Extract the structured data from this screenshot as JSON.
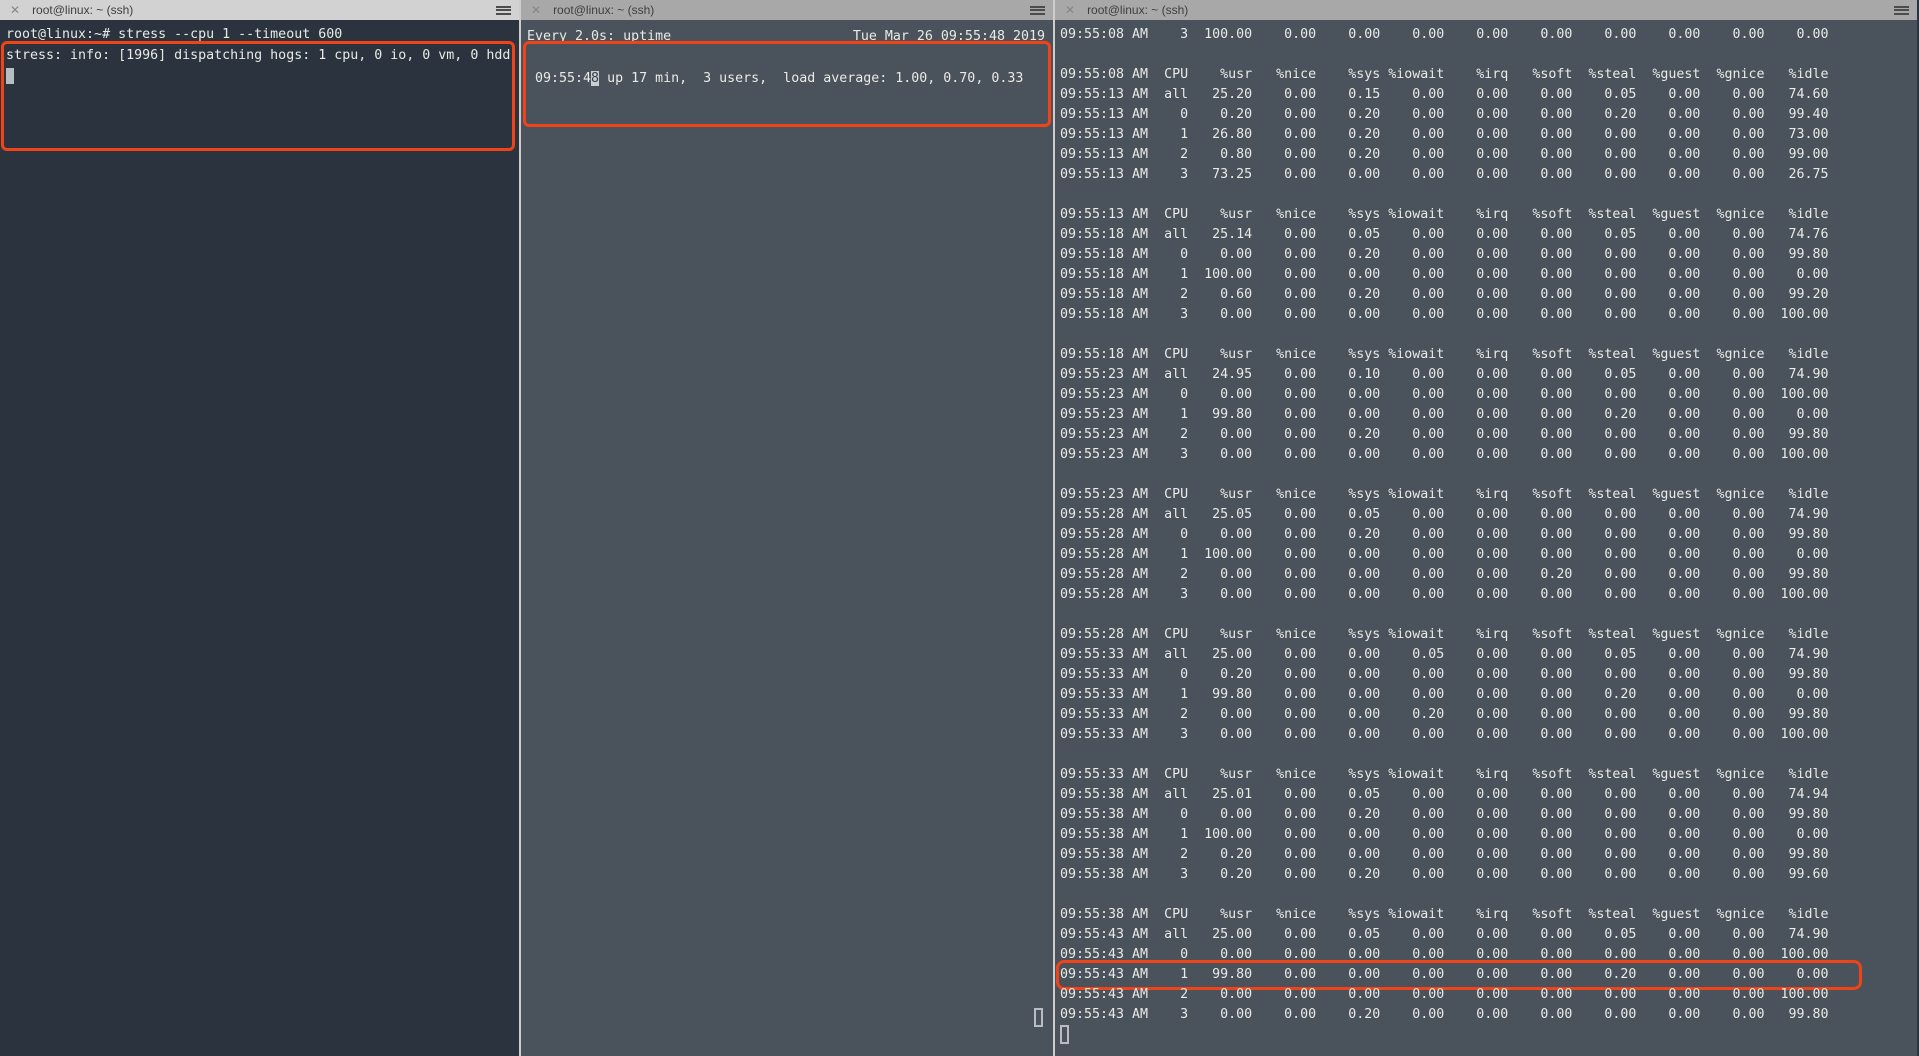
{
  "colors": {
    "accent_red": "#f04318",
    "left_pane_bg": "#2b333f",
    "slate_pane_bg": "#4a525c",
    "active_title_bg": "#d2d2d2",
    "inactive_title_bg": "#a8a8a8"
  },
  "panes": {
    "left": {
      "title": "root@linux: ~ (ssh)",
      "line1": "root@linux:~# stress --cpu 1 --timeout 600",
      "line2": "stress: info: [1996] dispatching hogs: 1 cpu, 0 io, 0 vm, 0 hdd"
    },
    "middle": {
      "title": "root@linux: ~ (ssh)",
      "watch_left": "Every 2.0s: uptime",
      "watch_right": "Tue Mar 26 09:55:48 2019",
      "uptime_pre": " 09:55:4",
      "uptime_cursor_char": "8",
      "uptime_post": " up 17 min,  3 users,  load average: 1.00, 0.70, 0.33"
    },
    "right": {
      "title": "root@linux: ~ (ssh)",
      "first_row": {
        "time": "09:55:08 AM",
        "cpu": "3",
        "values": [
          "100.00",
          "0.00",
          "0.00",
          "0.00",
          "0.00",
          "0.00",
          "0.00",
          "0.00",
          "0.00",
          "0.00"
        ]
      },
      "header_cols": [
        "CPU",
        "%usr",
        "%nice",
        "%sys",
        "%iowait",
        "%irq",
        "%soft",
        "%steal",
        "%guest",
        "%gnice",
        "%idle"
      ],
      "blocks": [
        {
          "header_time": "09:55:08 AM",
          "rows": [
            {
              "time": "09:55:13 AM",
              "cpu": "all",
              "values": [
                "25.20",
                "0.00",
                "0.15",
                "0.00",
                "0.00",
                "0.00",
                "0.05",
                "0.00",
                "0.00",
                "74.60"
              ]
            },
            {
              "time": "09:55:13 AM",
              "cpu": "0",
              "values": [
                "0.20",
                "0.00",
                "0.20",
                "0.00",
                "0.00",
                "0.00",
                "0.20",
                "0.00",
                "0.00",
                "99.40"
              ]
            },
            {
              "time": "09:55:13 AM",
              "cpu": "1",
              "values": [
                "26.80",
                "0.00",
                "0.20",
                "0.00",
                "0.00",
                "0.00",
                "0.00",
                "0.00",
                "0.00",
                "73.00"
              ]
            },
            {
              "time": "09:55:13 AM",
              "cpu": "2",
              "values": [
                "0.80",
                "0.00",
                "0.20",
                "0.00",
                "0.00",
                "0.00",
                "0.00",
                "0.00",
                "0.00",
                "99.00"
              ]
            },
            {
              "time": "09:55:13 AM",
              "cpu": "3",
              "values": [
                "73.25",
                "0.00",
                "0.00",
                "0.00",
                "0.00",
                "0.00",
                "0.00",
                "0.00",
                "0.00",
                "26.75"
              ]
            }
          ]
        },
        {
          "header_time": "09:55:13 AM",
          "rows": [
            {
              "time": "09:55:18 AM",
              "cpu": "all",
              "values": [
                "25.14",
                "0.00",
                "0.05",
                "0.00",
                "0.00",
                "0.00",
                "0.05",
                "0.00",
                "0.00",
                "74.76"
              ]
            },
            {
              "time": "09:55:18 AM",
              "cpu": "0",
              "values": [
                "0.00",
                "0.00",
                "0.20",
                "0.00",
                "0.00",
                "0.00",
                "0.00",
                "0.00",
                "0.00",
                "99.80"
              ]
            },
            {
              "time": "09:55:18 AM",
              "cpu": "1",
              "values": [
                "100.00",
                "0.00",
                "0.00",
                "0.00",
                "0.00",
                "0.00",
                "0.00",
                "0.00",
                "0.00",
                "0.00"
              ]
            },
            {
              "time": "09:55:18 AM",
              "cpu": "2",
              "values": [
                "0.60",
                "0.00",
                "0.20",
                "0.00",
                "0.00",
                "0.00",
                "0.00",
                "0.00",
                "0.00",
                "99.20"
              ]
            },
            {
              "time": "09:55:18 AM",
              "cpu": "3",
              "values": [
                "0.00",
                "0.00",
                "0.00",
                "0.00",
                "0.00",
                "0.00",
                "0.00",
                "0.00",
                "0.00",
                "100.00"
              ]
            }
          ]
        },
        {
          "header_time": "09:55:18 AM",
          "rows": [
            {
              "time": "09:55:23 AM",
              "cpu": "all",
              "values": [
                "24.95",
                "0.00",
                "0.10",
                "0.00",
                "0.00",
                "0.00",
                "0.05",
                "0.00",
                "0.00",
                "74.90"
              ]
            },
            {
              "time": "09:55:23 AM",
              "cpu": "0",
              "values": [
                "0.00",
                "0.00",
                "0.00",
                "0.00",
                "0.00",
                "0.00",
                "0.00",
                "0.00",
                "0.00",
                "100.00"
              ]
            },
            {
              "time": "09:55:23 AM",
              "cpu": "1",
              "values": [
                "99.80",
                "0.00",
                "0.00",
                "0.00",
                "0.00",
                "0.00",
                "0.20",
                "0.00",
                "0.00",
                "0.00"
              ]
            },
            {
              "time": "09:55:23 AM",
              "cpu": "2",
              "values": [
                "0.00",
                "0.00",
                "0.20",
                "0.00",
                "0.00",
                "0.00",
                "0.00",
                "0.00",
                "0.00",
                "99.80"
              ]
            },
            {
              "time": "09:55:23 AM",
              "cpu": "3",
              "values": [
                "0.00",
                "0.00",
                "0.00",
                "0.00",
                "0.00",
                "0.00",
                "0.00",
                "0.00",
                "0.00",
                "100.00"
              ]
            }
          ]
        },
        {
          "header_time": "09:55:23 AM",
          "rows": [
            {
              "time": "09:55:28 AM",
              "cpu": "all",
              "values": [
                "25.05",
                "0.00",
                "0.05",
                "0.00",
                "0.00",
                "0.00",
                "0.00",
                "0.00",
                "0.00",
                "74.90"
              ]
            },
            {
              "time": "09:55:28 AM",
              "cpu": "0",
              "values": [
                "0.00",
                "0.00",
                "0.20",
                "0.00",
                "0.00",
                "0.00",
                "0.00",
                "0.00",
                "0.00",
                "99.80"
              ]
            },
            {
              "time": "09:55:28 AM",
              "cpu": "1",
              "values": [
                "100.00",
                "0.00",
                "0.00",
                "0.00",
                "0.00",
                "0.00",
                "0.00",
                "0.00",
                "0.00",
                "0.00"
              ]
            },
            {
              "time": "09:55:28 AM",
              "cpu": "2",
              "values": [
                "0.00",
                "0.00",
                "0.00",
                "0.00",
                "0.00",
                "0.20",
                "0.00",
                "0.00",
                "0.00",
                "99.80"
              ]
            },
            {
              "time": "09:55:28 AM",
              "cpu": "3",
              "values": [
                "0.00",
                "0.00",
                "0.00",
                "0.00",
                "0.00",
                "0.00",
                "0.00",
                "0.00",
                "0.00",
                "100.00"
              ]
            }
          ]
        },
        {
          "header_time": "09:55:28 AM",
          "rows": [
            {
              "time": "09:55:33 AM",
              "cpu": "all",
              "values": [
                "25.00",
                "0.00",
                "0.00",
                "0.05",
                "0.00",
                "0.00",
                "0.05",
                "0.00",
                "0.00",
                "74.90"
              ]
            },
            {
              "time": "09:55:33 AM",
              "cpu": "0",
              "values": [
                "0.20",
                "0.00",
                "0.00",
                "0.00",
                "0.00",
                "0.00",
                "0.00",
                "0.00",
                "0.00",
                "99.80"
              ]
            },
            {
              "time": "09:55:33 AM",
              "cpu": "1",
              "values": [
                "99.80",
                "0.00",
                "0.00",
                "0.00",
                "0.00",
                "0.00",
                "0.20",
                "0.00",
                "0.00",
                "0.00"
              ]
            },
            {
              "time": "09:55:33 AM",
              "cpu": "2",
              "values": [
                "0.00",
                "0.00",
                "0.00",
                "0.20",
                "0.00",
                "0.00",
                "0.00",
                "0.00",
                "0.00",
                "99.80"
              ]
            },
            {
              "time": "09:55:33 AM",
              "cpu": "3",
              "values": [
                "0.00",
                "0.00",
                "0.00",
                "0.00",
                "0.00",
                "0.00",
                "0.00",
                "0.00",
                "0.00",
                "100.00"
              ]
            }
          ]
        },
        {
          "header_time": "09:55:33 AM",
          "rows": [
            {
              "time": "09:55:38 AM",
              "cpu": "all",
              "values": [
                "25.01",
                "0.00",
                "0.05",
                "0.00",
                "0.00",
                "0.00",
                "0.00",
                "0.00",
                "0.00",
                "74.94"
              ]
            },
            {
              "time": "09:55:38 AM",
              "cpu": "0",
              "values": [
                "0.00",
                "0.00",
                "0.20",
                "0.00",
                "0.00",
                "0.00",
                "0.00",
                "0.00",
                "0.00",
                "99.80"
              ]
            },
            {
              "time": "09:55:38 AM",
              "cpu": "1",
              "values": [
                "100.00",
                "0.00",
                "0.00",
                "0.00",
                "0.00",
                "0.00",
                "0.00",
                "0.00",
                "0.00",
                "0.00"
              ]
            },
            {
              "time": "09:55:38 AM",
              "cpu": "2",
              "values": [
                "0.20",
                "0.00",
                "0.00",
                "0.00",
                "0.00",
                "0.00",
                "0.00",
                "0.00",
                "0.00",
                "99.80"
              ]
            },
            {
              "time": "09:55:38 AM",
              "cpu": "3",
              "values": [
                "0.20",
                "0.00",
                "0.20",
                "0.00",
                "0.00",
                "0.00",
                "0.00",
                "0.00",
                "0.00",
                "99.60"
              ]
            }
          ]
        },
        {
          "header_time": "09:55:38 AM",
          "rows": [
            {
              "time": "09:55:43 AM",
              "cpu": "all",
              "values": [
                "25.00",
                "0.00",
                "0.05",
                "0.00",
                "0.00",
                "0.00",
                "0.05",
                "0.00",
                "0.00",
                "74.90"
              ]
            },
            {
              "time": "09:55:43 AM",
              "cpu": "0",
              "values": [
                "0.00",
                "0.00",
                "0.00",
                "0.00",
                "0.00",
                "0.00",
                "0.00",
                "0.00",
                "0.00",
                "100.00"
              ]
            },
            {
              "time": "09:55:43 AM",
              "cpu": "1",
              "values": [
                "99.80",
                "0.00",
                "0.00",
                "0.00",
                "0.00",
                "0.00",
                "0.20",
                "0.00",
                "0.00",
                "0.00"
              ]
            },
            {
              "time": "09:55:43 AM",
              "cpu": "2",
              "values": [
                "0.00",
                "0.00",
                "0.00",
                "0.00",
                "0.00",
                "0.00",
                "0.00",
                "0.00",
                "0.00",
                "100.00"
              ]
            },
            {
              "time": "09:55:43 AM",
              "cpu": "3",
              "values": [
                "0.00",
                "0.00",
                "0.20",
                "0.00",
                "0.00",
                "0.00",
                "0.00",
                "0.00",
                "0.00",
                "99.80"
              ]
            }
          ]
        }
      ],
      "highlight_row": {
        "block": 6,
        "row": 2
      }
    }
  }
}
